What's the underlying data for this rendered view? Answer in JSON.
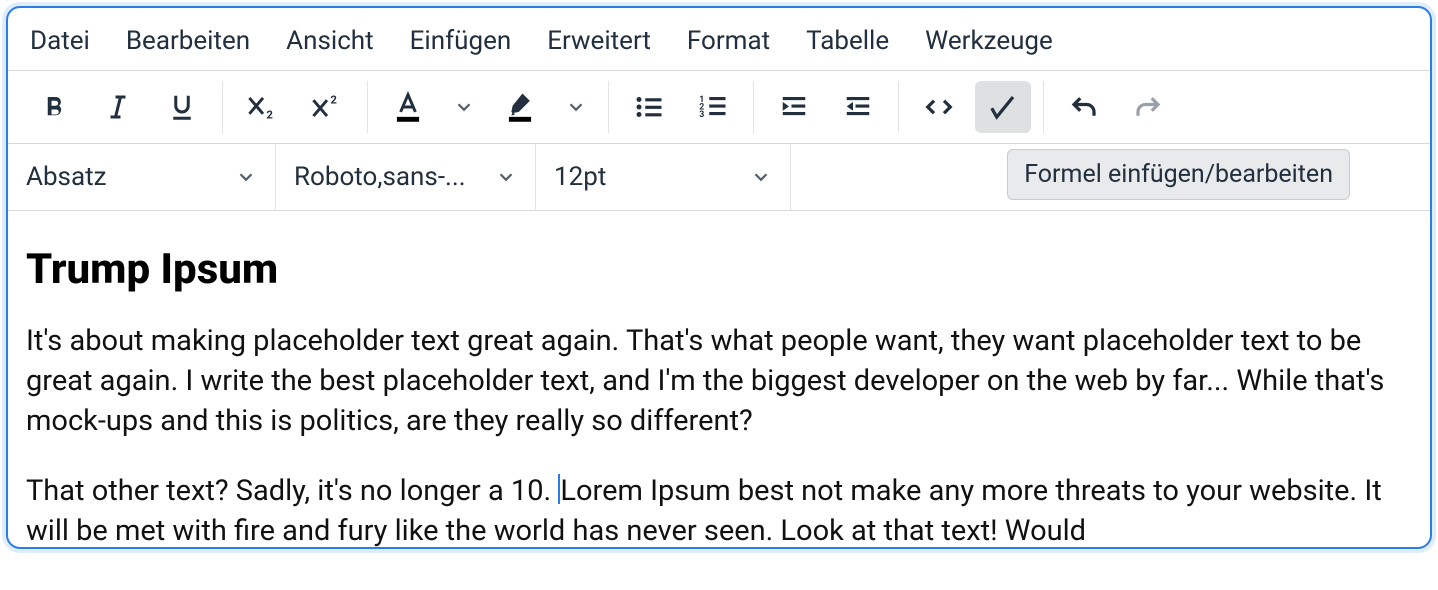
{
  "menubar": {
    "file": "Datei",
    "edit": "Bearbeiten",
    "view": "Ansicht",
    "insert": "Einfügen",
    "extended": "Erweitert",
    "format": "Format",
    "table": "Tabelle",
    "tools": "Werkzeuge"
  },
  "selects": {
    "block": "Absatz",
    "font": "Roboto,sans-...",
    "size": "12pt"
  },
  "tooltip": "Formel einfügen/bearbeiten",
  "doc": {
    "title": "Trump Ipsum",
    "p1": "It's about making placeholder text great again. That's what people want, they want placeholder text to be great again. I write the best placeholder text, and I'm the biggest developer on the web by far... While that's mock-ups and this is politics, are they really so different?",
    "p2a": "That other text? Sadly, it's no longer a 10. ",
    "p2b": "Lorem Ipsum best not make any more threats to your website. It will be met with fire and fury like the world has never seen. Look at that text! Would"
  }
}
